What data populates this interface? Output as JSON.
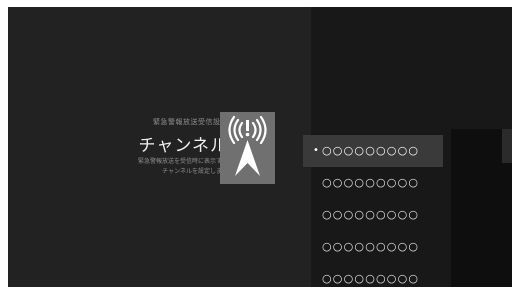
{
  "settings": {
    "subtitle": "緊急警報放送受信設定",
    "title": "チャンネル",
    "description": [
      "緊急警報放送を受信時に表示する",
      "チャンネルを設定します"
    ],
    "icon": "broadcast-tower-icon"
  },
  "menu": {
    "selected_index": 0,
    "selected_marker": "•",
    "items": [
      {
        "label": "○○○○○○○○○"
      },
      {
        "label": "○○○○○○○○○"
      },
      {
        "label": "○○○○○○○○○"
      },
      {
        "label": "○○○○○○○○○"
      },
      {
        "label": "○○○○○○○○○"
      }
    ]
  },
  "colors": {
    "background": "#1d1d1d",
    "icon_box": "#707070",
    "selected_row": "#3a3a3a",
    "text": "#f0f0f0"
  }
}
